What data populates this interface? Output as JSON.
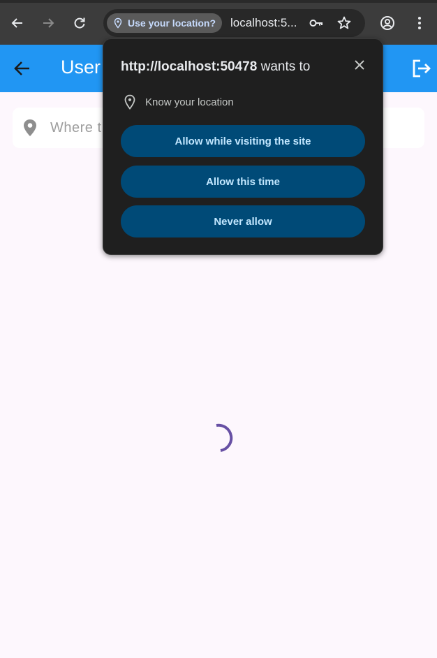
{
  "browser": {
    "location_chip_label": "Use your location?",
    "url": "localhost:5...",
    "icons": {
      "back": "arrow-left-icon",
      "forward": "arrow-right-icon",
      "reload": "reload-icon",
      "location": "location-pin-icon",
      "password": "key-icon",
      "bookmark": "star-icon",
      "profile": "account-circle-icon",
      "menu": "kebab-menu-icon"
    }
  },
  "app": {
    "title": "User",
    "search_placeholder": "Where t",
    "accent_color": "#2196f3",
    "spinner_color": "#6750a4"
  },
  "permission_popup": {
    "origin": "http://localhost:50478",
    "wants_to": " wants to",
    "permission": "Know your location",
    "buttons": {
      "allow_visiting": "Allow while visiting the site",
      "allow_once": "Allow this time",
      "never": "Never allow"
    }
  }
}
